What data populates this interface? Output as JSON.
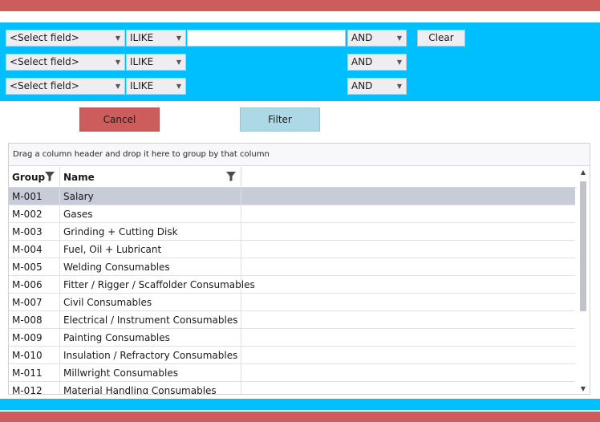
{
  "colors": {
    "accent_red": "#cd5c5c",
    "accent_cyan": "#00bfff",
    "filter_button": "#add8e6",
    "selected_row": "#c8cbd8"
  },
  "filter_rows": [
    {
      "field": "<Select field>",
      "operator": "ILIKE",
      "value": "",
      "logic": "AND"
    },
    {
      "field": "<Select field>",
      "operator": "ILIKE",
      "logic": "AND"
    },
    {
      "field": "<Select field>",
      "operator": "ILIKE",
      "logic": "AND"
    }
  ],
  "buttons": {
    "clear": "Clear",
    "cancel": "Cancel",
    "filter": "Filter"
  },
  "grid": {
    "group_hint": "Drag a column header and drop it here to group by that column",
    "columns": [
      "Group",
      "Name"
    ],
    "rows": [
      {
        "group": "M-001",
        "name": "Salary"
      },
      {
        "group": "M-002",
        "name": "Gases"
      },
      {
        "group": "M-003",
        "name": "Grinding + Cutting Disk"
      },
      {
        "group": "M-004",
        "name": "Fuel, Oil + Lubricant"
      },
      {
        "group": "M-005",
        "name": "Welding Consumables"
      },
      {
        "group": "M-006",
        "name": "Fitter / Rigger / Scaffolder Consumables"
      },
      {
        "group": "M-007",
        "name": "Civil Consumables"
      },
      {
        "group": "M-008",
        "name": "Electrical / Instrument Consumables"
      },
      {
        "group": "M-009",
        "name": "Painting Consumables"
      },
      {
        "group": "M-010",
        "name": "Insulation / Refractory Consumables"
      },
      {
        "group": "M-011",
        "name": "Millwright Consumables"
      },
      {
        "group": "M-012",
        "name": "Material Handling Consumables"
      }
    ]
  }
}
